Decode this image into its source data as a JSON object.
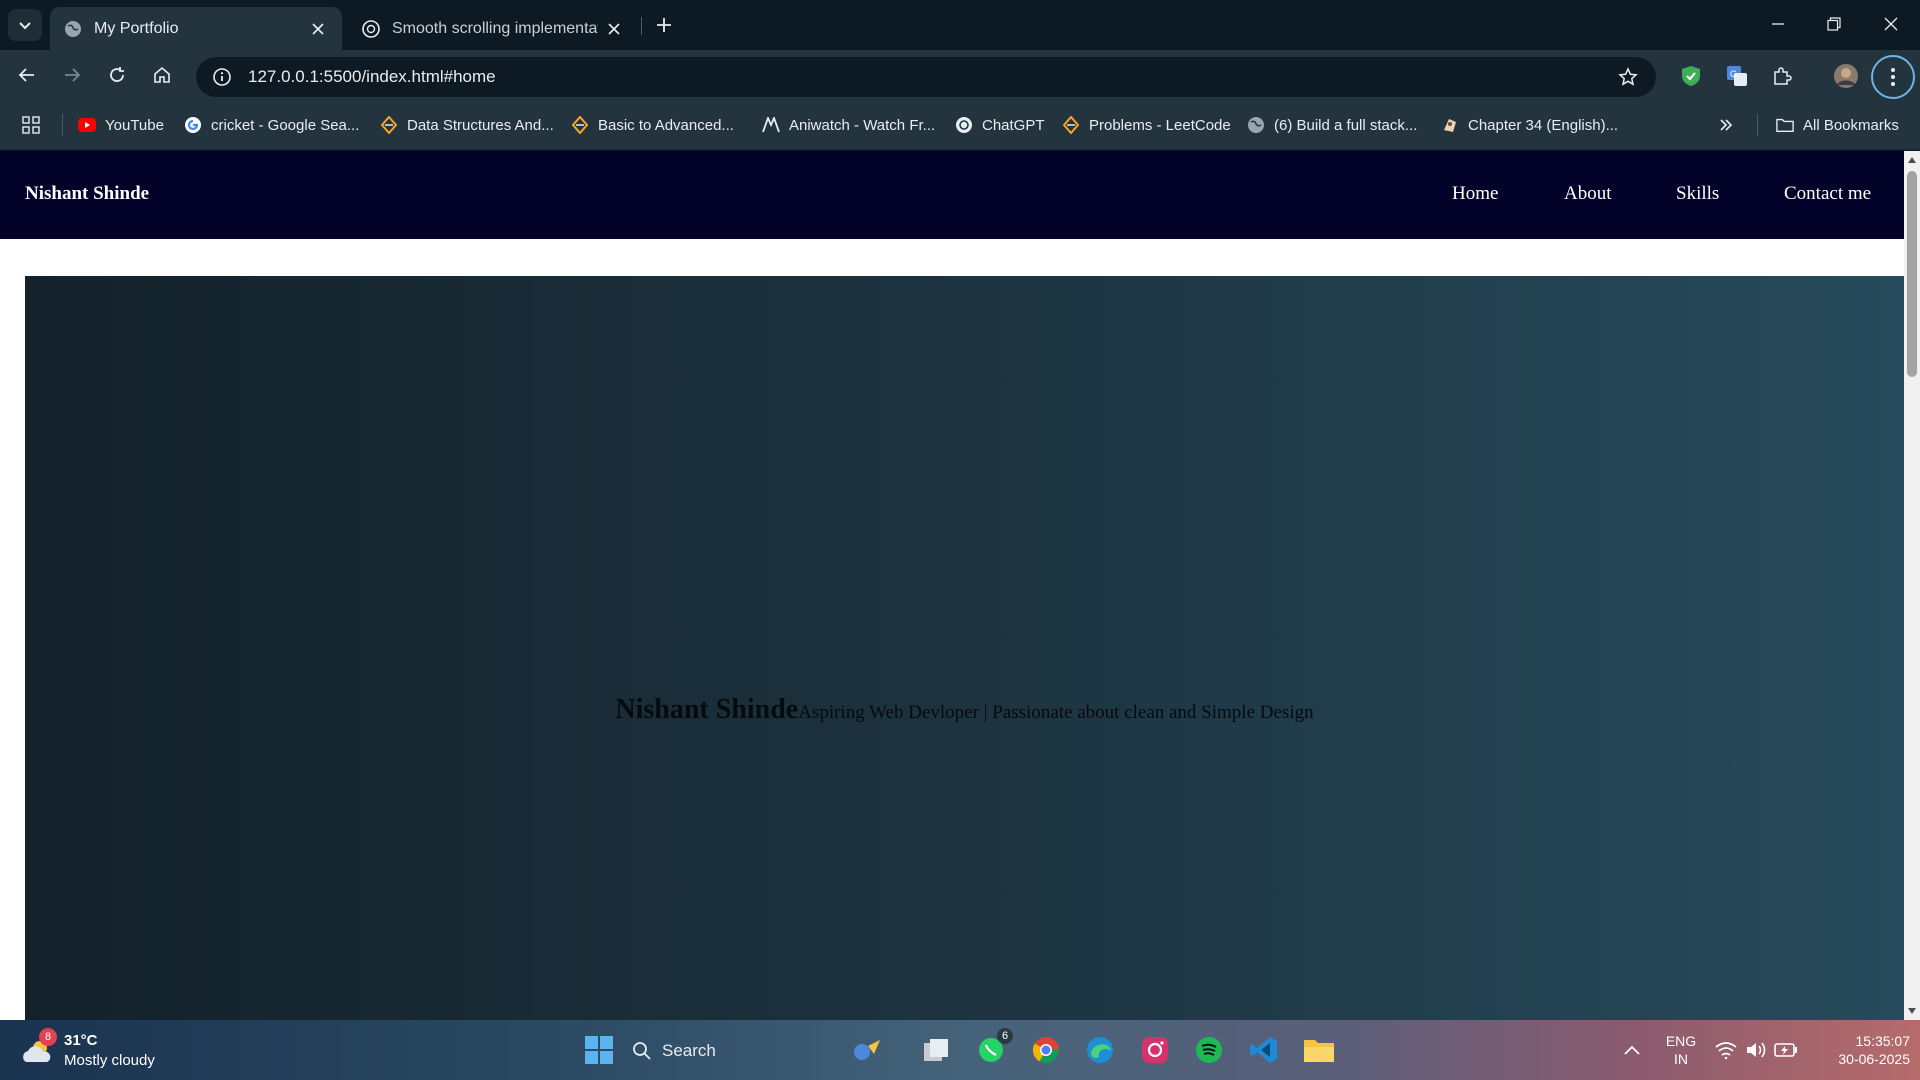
{
  "browser": {
    "tabs": [
      {
        "title": "My Portfolio",
        "active": true
      },
      {
        "title": "Smooth scrolling implementatio",
        "active": false
      }
    ],
    "url": "127.0.0.1:5500/index.html#home",
    "bookmarks": [
      {
        "label": "YouTube",
        "icon": "youtube-icon"
      },
      {
        "label": "cricket - Google Sea...",
        "icon": "google-icon"
      },
      {
        "label": "Data Structures And...",
        "icon": "codestudio-icon"
      },
      {
        "label": "Basic to Advanced...",
        "icon": "codestudio-icon"
      },
      {
        "label": "Aniwatch - Watch Fr...",
        "icon": "aniwatch-icon"
      },
      {
        "label": "ChatGPT",
        "icon": "chatgpt-icon"
      },
      {
        "label": "Problems - LeetCode",
        "icon": "leetcode-icon"
      },
      {
        "label": "(6) Build a full stack...",
        "icon": "globe-icon"
      },
      {
        "label": "Chapter 34 (English)...",
        "icon": "manga-icon"
      }
    ],
    "all_bookmarks_label": "All Bookmarks"
  },
  "site": {
    "brand": "Nishant Shinde",
    "nav": [
      "Home",
      "About",
      "Skills",
      "Contact me"
    ],
    "hero": {
      "name": "Nishant Shinde",
      "tagline": "Aspiring Web Devloper | Passionate about clean and Simple Design"
    }
  },
  "taskbar": {
    "weather": {
      "temp": "31°C",
      "condition": "Mostly cloudy",
      "badge": "8"
    },
    "search_label": "Search",
    "whatsapp_badge": "6",
    "language": "ENG",
    "region": "IN",
    "time": "15:35:07",
    "date": "30-06-2025"
  },
  "colors": {
    "site_nav": "#03032a",
    "hero_gradient_start": "#13212a",
    "hero_gradient_end": "#274b5c",
    "browser_frame": "#24343f"
  }
}
